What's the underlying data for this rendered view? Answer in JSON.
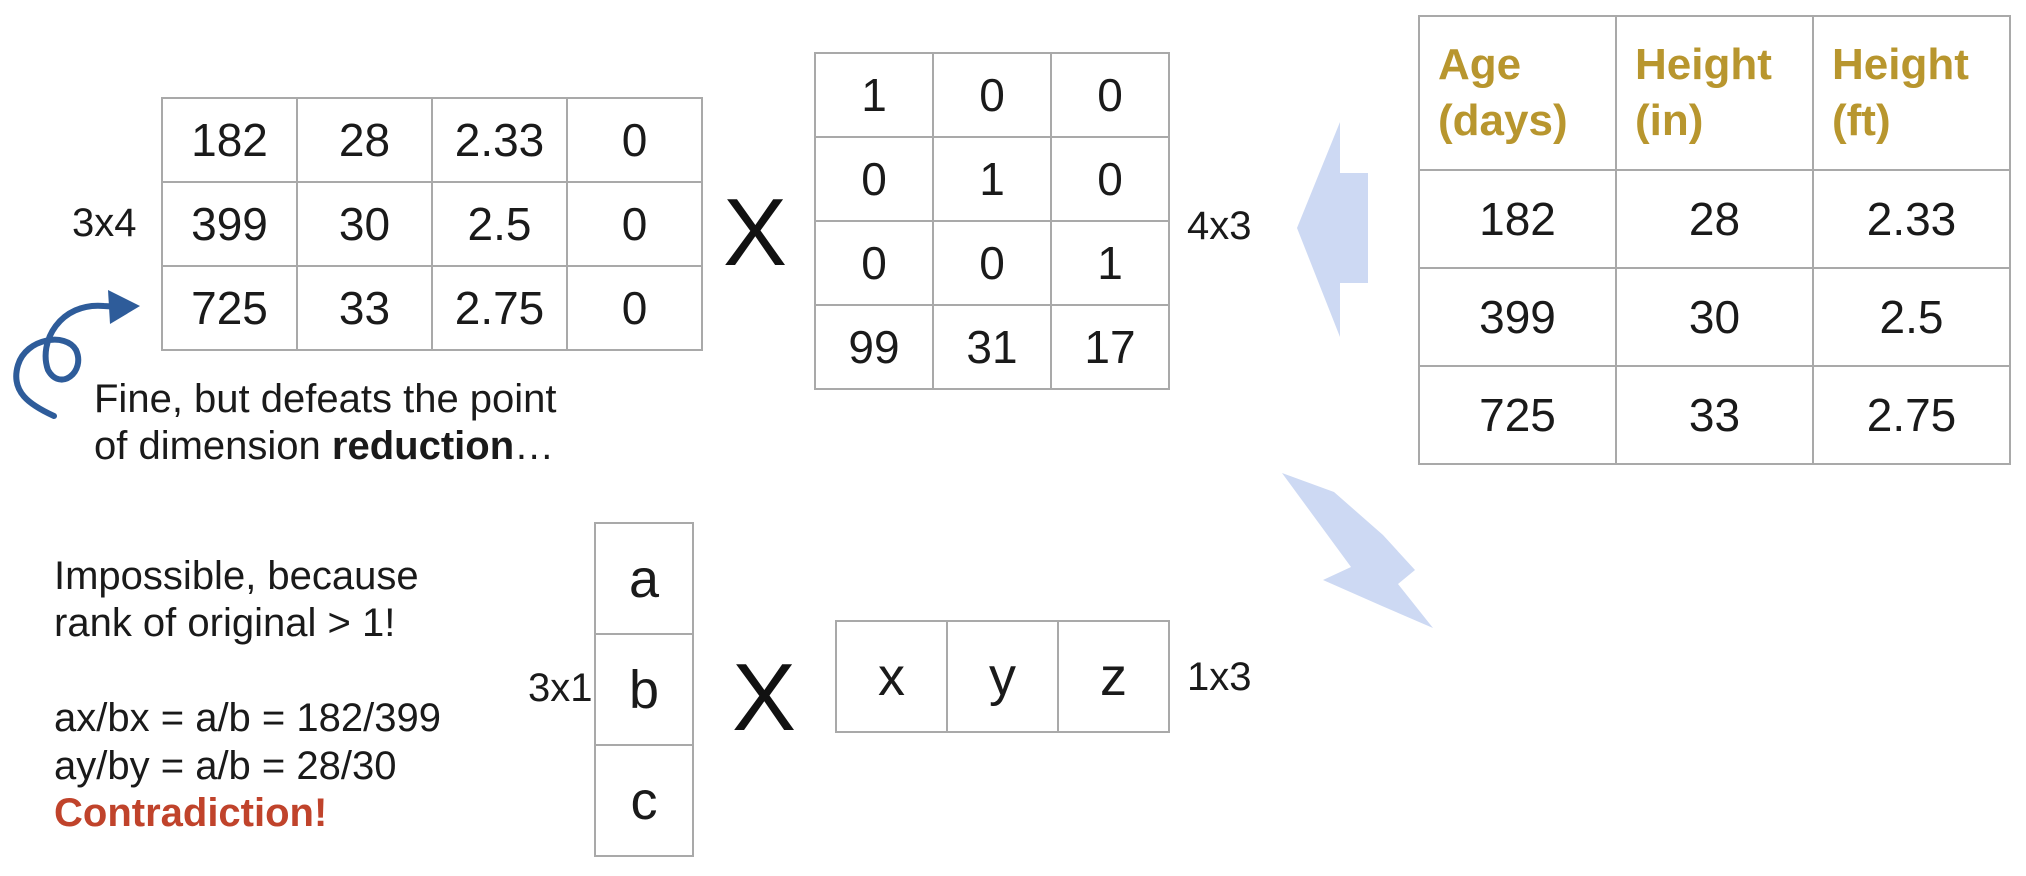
{
  "original_table": {
    "headers": [
      [
        "Age",
        "(days)"
      ],
      [
        "Height",
        "(in)"
      ],
      [
        "Height",
        "(ft)"
      ]
    ],
    "rows": [
      [
        "182",
        "28",
        "2.33"
      ],
      [
        "399",
        "30",
        "2.5"
      ],
      [
        "725",
        "33",
        "2.75"
      ]
    ]
  },
  "matrix_a": {
    "dim_label": "3x4",
    "rows": [
      [
        "182",
        "28",
        "2.33",
        "0"
      ],
      [
        "399",
        "30",
        "2.5",
        "0"
      ],
      [
        "725",
        "33",
        "2.75",
        "0"
      ]
    ]
  },
  "matrix_b": {
    "dim_label": "4x3",
    "rows": [
      [
        "1",
        "0",
        "0"
      ],
      [
        "0",
        "1",
        "0"
      ],
      [
        "0",
        "0",
        "1"
      ],
      [
        "99",
        "31",
        "17"
      ]
    ]
  },
  "column_vector": {
    "dim_label": "3x1",
    "cells": [
      "a",
      "b",
      "c"
    ]
  },
  "row_vector": {
    "dim_label": "1x3",
    "cells": [
      "x",
      "y",
      "z"
    ]
  },
  "multiply_symbol": "X",
  "note_top": {
    "line1": "Fine, but defeats the point",
    "line2_prefix": "of dimension ",
    "line2_bold": "reduction",
    "line2_suffix": "…"
  },
  "note_bottom": {
    "line1": "Impossible, because",
    "line2": "rank of original > 1!",
    "eq1": "ax/bx = a/b = 182/399",
    "eq2": "ay/by = a/b = 28/30",
    "conclusion": "Contradiction!"
  },
  "colors": {
    "header_text": "#b8962e",
    "contradiction": "#c0432b",
    "curl_arrow": "#2e5c9a",
    "block_arrows": "#cdd9f3",
    "grid_lines": "#a9a9a9"
  },
  "icons": [
    "curly-arrow-icon",
    "left-block-arrow-icon",
    "down-left-block-arrow-icon"
  ]
}
